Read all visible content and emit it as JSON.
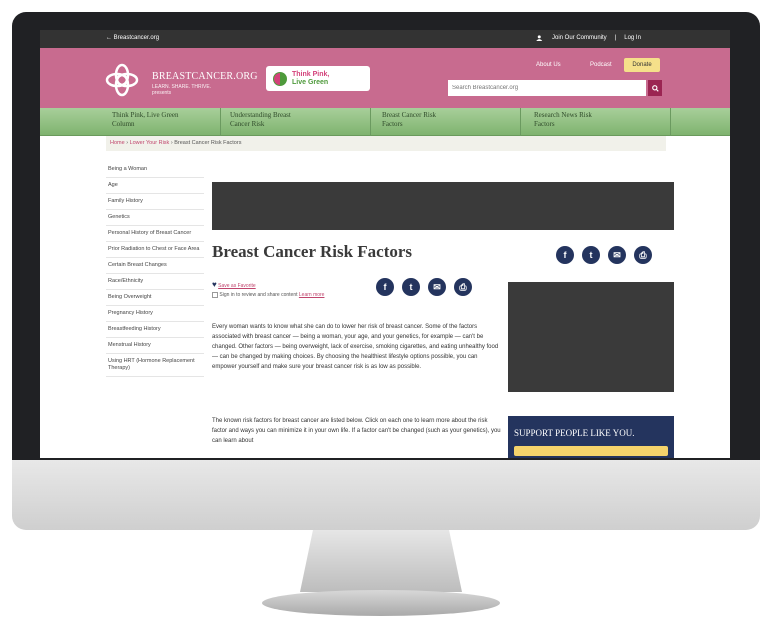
{
  "topbar": {
    "back": "← Breastcancer.org",
    "join": "Join Our Community",
    "login": "Log In",
    "sep": "|"
  },
  "header": {
    "logo_name": "BREASTCANCER.ORG",
    "logo_sub1": "LEARN. SHARE. THRIVE.",
    "logo_sub2": "presents",
    "think_pink": "Think Pink,",
    "live_green": "Live Green",
    "about": "About Us",
    "podcast": "Podcast",
    "donate": "Donate",
    "search_placeholder": "Search Breastcancer.org"
  },
  "nav": {
    "items": [
      {
        "l1": "Think Pink, Live Green",
        "l2": "Column"
      },
      {
        "l1": "Understanding Breast",
        "l2": "Cancer Risk"
      },
      {
        "l1": "Breast Cancer Risk",
        "l2": "Factors"
      },
      {
        "l1": "Research News Risk",
        "l2": "Factors"
      }
    ]
  },
  "breadcrumb": {
    "home": "Home",
    "sep1": " › ",
    "lower": "Lower Your Risk",
    "sep2": " › ",
    "current": "Breast Cancer Risk Factors"
  },
  "sidebar": [
    "Being a Woman",
    "Age",
    "Family History",
    "Genetics",
    "Personal History of Breast Cancer",
    "Prior Radiation to Chest or Face Area",
    "Certain Breast Changes",
    "Race/Ethnicity",
    "Being Overweight",
    "Pregnancy History",
    "Breastfeeding History",
    "Menstrual History",
    "Using HRT (Hormone Replacement Therapy)"
  ],
  "main": {
    "title": "Breast Cancer Risk Factors",
    "save_link": "Save as Favorite",
    "signup": "Sign in to review and share content",
    "learn_more": "Learn more",
    "para1": "Every woman wants to know what she can do to lower her risk of breast cancer. Some of the factors associated with breast cancer — being a woman, your age, and your genetics, for example — can't be changed. Other factors — being overweight, lack of exercise, smoking cigarettes, and eating unhealthy food — can be changed by making choices. By choosing the healthiest lifestyle options possible, you can empower yourself and make sure your breast cancer risk is as low as possible.",
    "para2": "The known risk factors for breast cancer are listed below. Click on each one to learn more about the risk factor and ways you can minimize it in your own life. If a factor can't be changed (such as your genetics), you can learn about"
  },
  "social": {
    "icons": [
      "f",
      "t",
      "✉",
      "⎙"
    ]
  },
  "support": {
    "text": "SUPPORT PEOPLE LIKE YOU."
  }
}
